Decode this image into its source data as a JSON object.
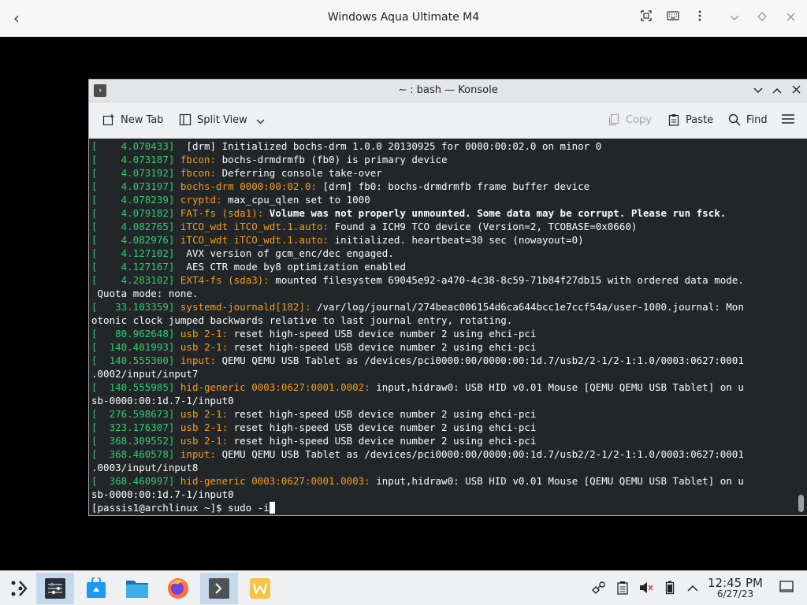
{
  "viewer": {
    "title": "Windows Aqua Ultimate M4",
    "back_glyph": "‹",
    "icons": [
      "fit-screen-icon",
      "keyboard-icon",
      "more-vert-icon",
      "chevron-down-icon",
      "diamond-icon",
      "close-icon"
    ]
  },
  "konsole": {
    "title": "~ : bash — Konsole",
    "toolbar": {
      "new_tab": "New Tab",
      "split_view": "Split View",
      "copy": "Copy",
      "paste": "Paste",
      "find": "Find"
    },
    "lines": [
      {
        "ts": "    4.070433",
        "src": "",
        "msg": " [drm] Initialized bochs-drm 1.0.0 20130925 for 0000:00:02.0 on minor 0",
        "bold": false
      },
      {
        "ts": "    4.073187",
        "src": "fbcon:",
        "msg": " bochs-drmdrmfb (fb0) is primary device",
        "bold": false
      },
      {
        "ts": "    4.073192",
        "src": "fbcon:",
        "msg": " Deferring console take-over",
        "bold": false
      },
      {
        "ts": "    4.073197",
        "src": "bochs-drm 0000:00:02.0:",
        "msg": " [drm] fb0: bochs-drmdrmfb frame buffer device",
        "bold": false
      },
      {
        "ts": "    4.078239",
        "src": "cryptd:",
        "msg": " max_cpu_qlen set to 1000",
        "bold": false
      },
      {
        "ts": "    4.079182",
        "src": "FAT-fs (sda1):",
        "msg": " Volume was not properly unmounted. Some data may be corrupt. Please run fsck.",
        "bold": true
      },
      {
        "ts": "    4.082765",
        "src": "iTCO_wdt iTCO_wdt.1.auto:",
        "msg": " Found a ICH9 TCO device (Version=2, TCOBASE=0x0660)",
        "bold": false
      },
      {
        "ts": "    4.082976",
        "src": "iTCO_wdt iTCO_wdt.1.auto:",
        "msg": " initialized. heartbeat=30 sec (nowayout=0)",
        "bold": false
      },
      {
        "ts": "    4.127102",
        "src": "",
        "msg": " AVX version of gcm_enc/dec engaged.",
        "bold": false
      },
      {
        "ts": "    4.127167",
        "src": "",
        "msg": " AES CTR mode by8 optimization enabled",
        "bold": false
      },
      {
        "ts": "    4.283102",
        "src": "EXT4-fs (sda3):",
        "msg": " mounted filesystem 69045e92-a470-4c38-8c59-71b84f27db15 with ordered data mode.",
        "bold": false
      },
      {
        "cont": " Quota mode: none."
      },
      {
        "ts": "   33.103359",
        "src": "systemd-journald[182]:",
        "msg": " /var/log/journal/274beac006154d6ca644bcc1e7ccf54a/user-1000.journal: Mon",
        "bold": false
      },
      {
        "cont": "otonic clock jumped backwards relative to last journal entry, rotating."
      },
      {
        "ts": "   80.962648",
        "src": "usb 2-1:",
        "msg": " reset high-speed USB device number 2 using ehci-pci",
        "bold": false
      },
      {
        "ts": "  140.401993",
        "src": "usb 2-1:",
        "msg": " reset high-speed USB device number 2 using ehci-pci",
        "bold": false
      },
      {
        "ts": "  140.555300",
        "src": "input:",
        "msg": " QEMU QEMU USB Tablet as /devices/pci0000:00/0000:00:1d.7/usb2/2-1/2-1:1.0/0003:0627:0001",
        "bold": false
      },
      {
        "cont": ".0002/input/input7"
      },
      {
        "ts": "  140.555985",
        "src": "hid-generic 0003:0627:0001.0002:",
        "msg": " input,hidraw0: USB HID v0.01 Mouse [QEMU QEMU USB Tablet] on u",
        "bold": false
      },
      {
        "cont": "sb-0000:00:1d.7-1/input0"
      },
      {
        "ts": "  276.598673",
        "src": "usb 2-1:",
        "msg": " reset high-speed USB device number 2 using ehci-pci",
        "bold": false
      },
      {
        "ts": "  323.176307",
        "src": "usb 2-1:",
        "msg": " reset high-speed USB device number 2 using ehci-pci",
        "bold": false
      },
      {
        "ts": "  368.309552",
        "src": "usb 2-1:",
        "msg": " reset high-speed USB device number 2 using ehci-pci",
        "bold": false
      },
      {
        "ts": "  368.460578",
        "src": "input:",
        "msg": " QEMU QEMU USB Tablet as /devices/pci0000:00/0000:00:1d.7/usb2/2-1/2-1:1.0/0003:0627:0001",
        "bold": false
      },
      {
        "cont": ".0003/input/input8"
      },
      {
        "ts": "  368.460997",
        "src": "hid-generic 0003:0627:0001.0003:",
        "msg": " input,hidraw0: USB HID v0.01 Mouse [QEMU QEMU USB Tablet] on u",
        "bold": false
      },
      {
        "cont": "sb-0000:00:1d.7-1/input0"
      }
    ],
    "prompt": "[passis1@archlinux ~]$ ",
    "command": "sudo -i"
  },
  "taskbar": {
    "apps": [
      "application-launcher-icon",
      "system-settings-icon",
      "discover-store-icon",
      "file-manager-icon",
      "firefox-icon",
      "konsole-icon",
      "winlator-icon"
    ],
    "clock_time": "12:45 PM",
    "clock_date": "6/27/23"
  },
  "colors": {
    "terminal_bg": "#232629",
    "timestamp": "#2ecc71",
    "source": "#f39c1f",
    "text": "#fcfcfc"
  }
}
